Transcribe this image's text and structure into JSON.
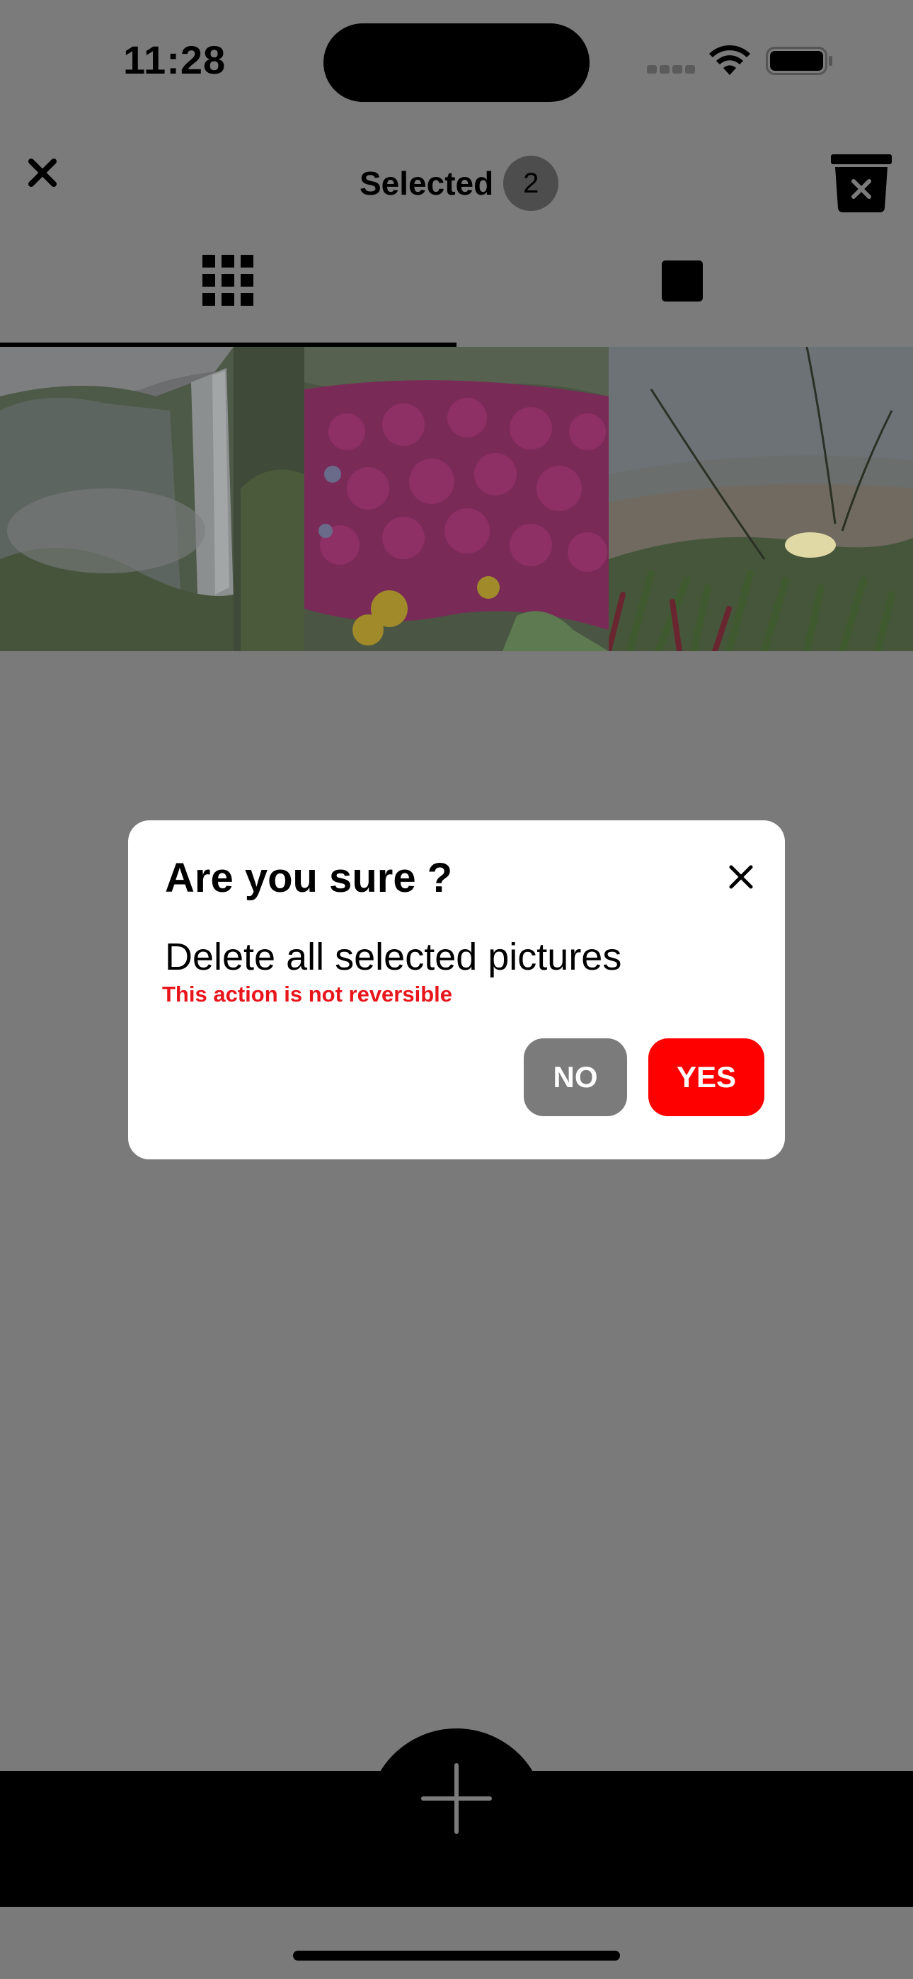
{
  "status_bar": {
    "time": "11:28",
    "icons": [
      "signal-icon",
      "wifi-icon",
      "battery-icon"
    ]
  },
  "toolbar": {
    "close_icon": "close-icon",
    "selected_label": "Selected",
    "selected_count": "2",
    "delete_icon": "trash-icon"
  },
  "view_tabs": [
    {
      "name": "grid-view",
      "icon": "grid-icon",
      "active": true
    },
    {
      "name": "single-view",
      "icon": "square-icon",
      "active": false
    }
  ],
  "photos": [
    {
      "subject": "waterfall"
    },
    {
      "subject": "pink flowers"
    },
    {
      "subject": "succulents with white flower"
    }
  ],
  "dialog": {
    "title": "Are you sure ?",
    "message": "Delete all selected pictures",
    "warning": "This action is not reversible",
    "no_label": "NO",
    "yes_label": "YES",
    "warning_color": "#e8151b",
    "yes_color": "#ff0000",
    "no_color": "#7b7b7b"
  },
  "bottom_bar": {
    "add_icon": "plus-icon"
  }
}
